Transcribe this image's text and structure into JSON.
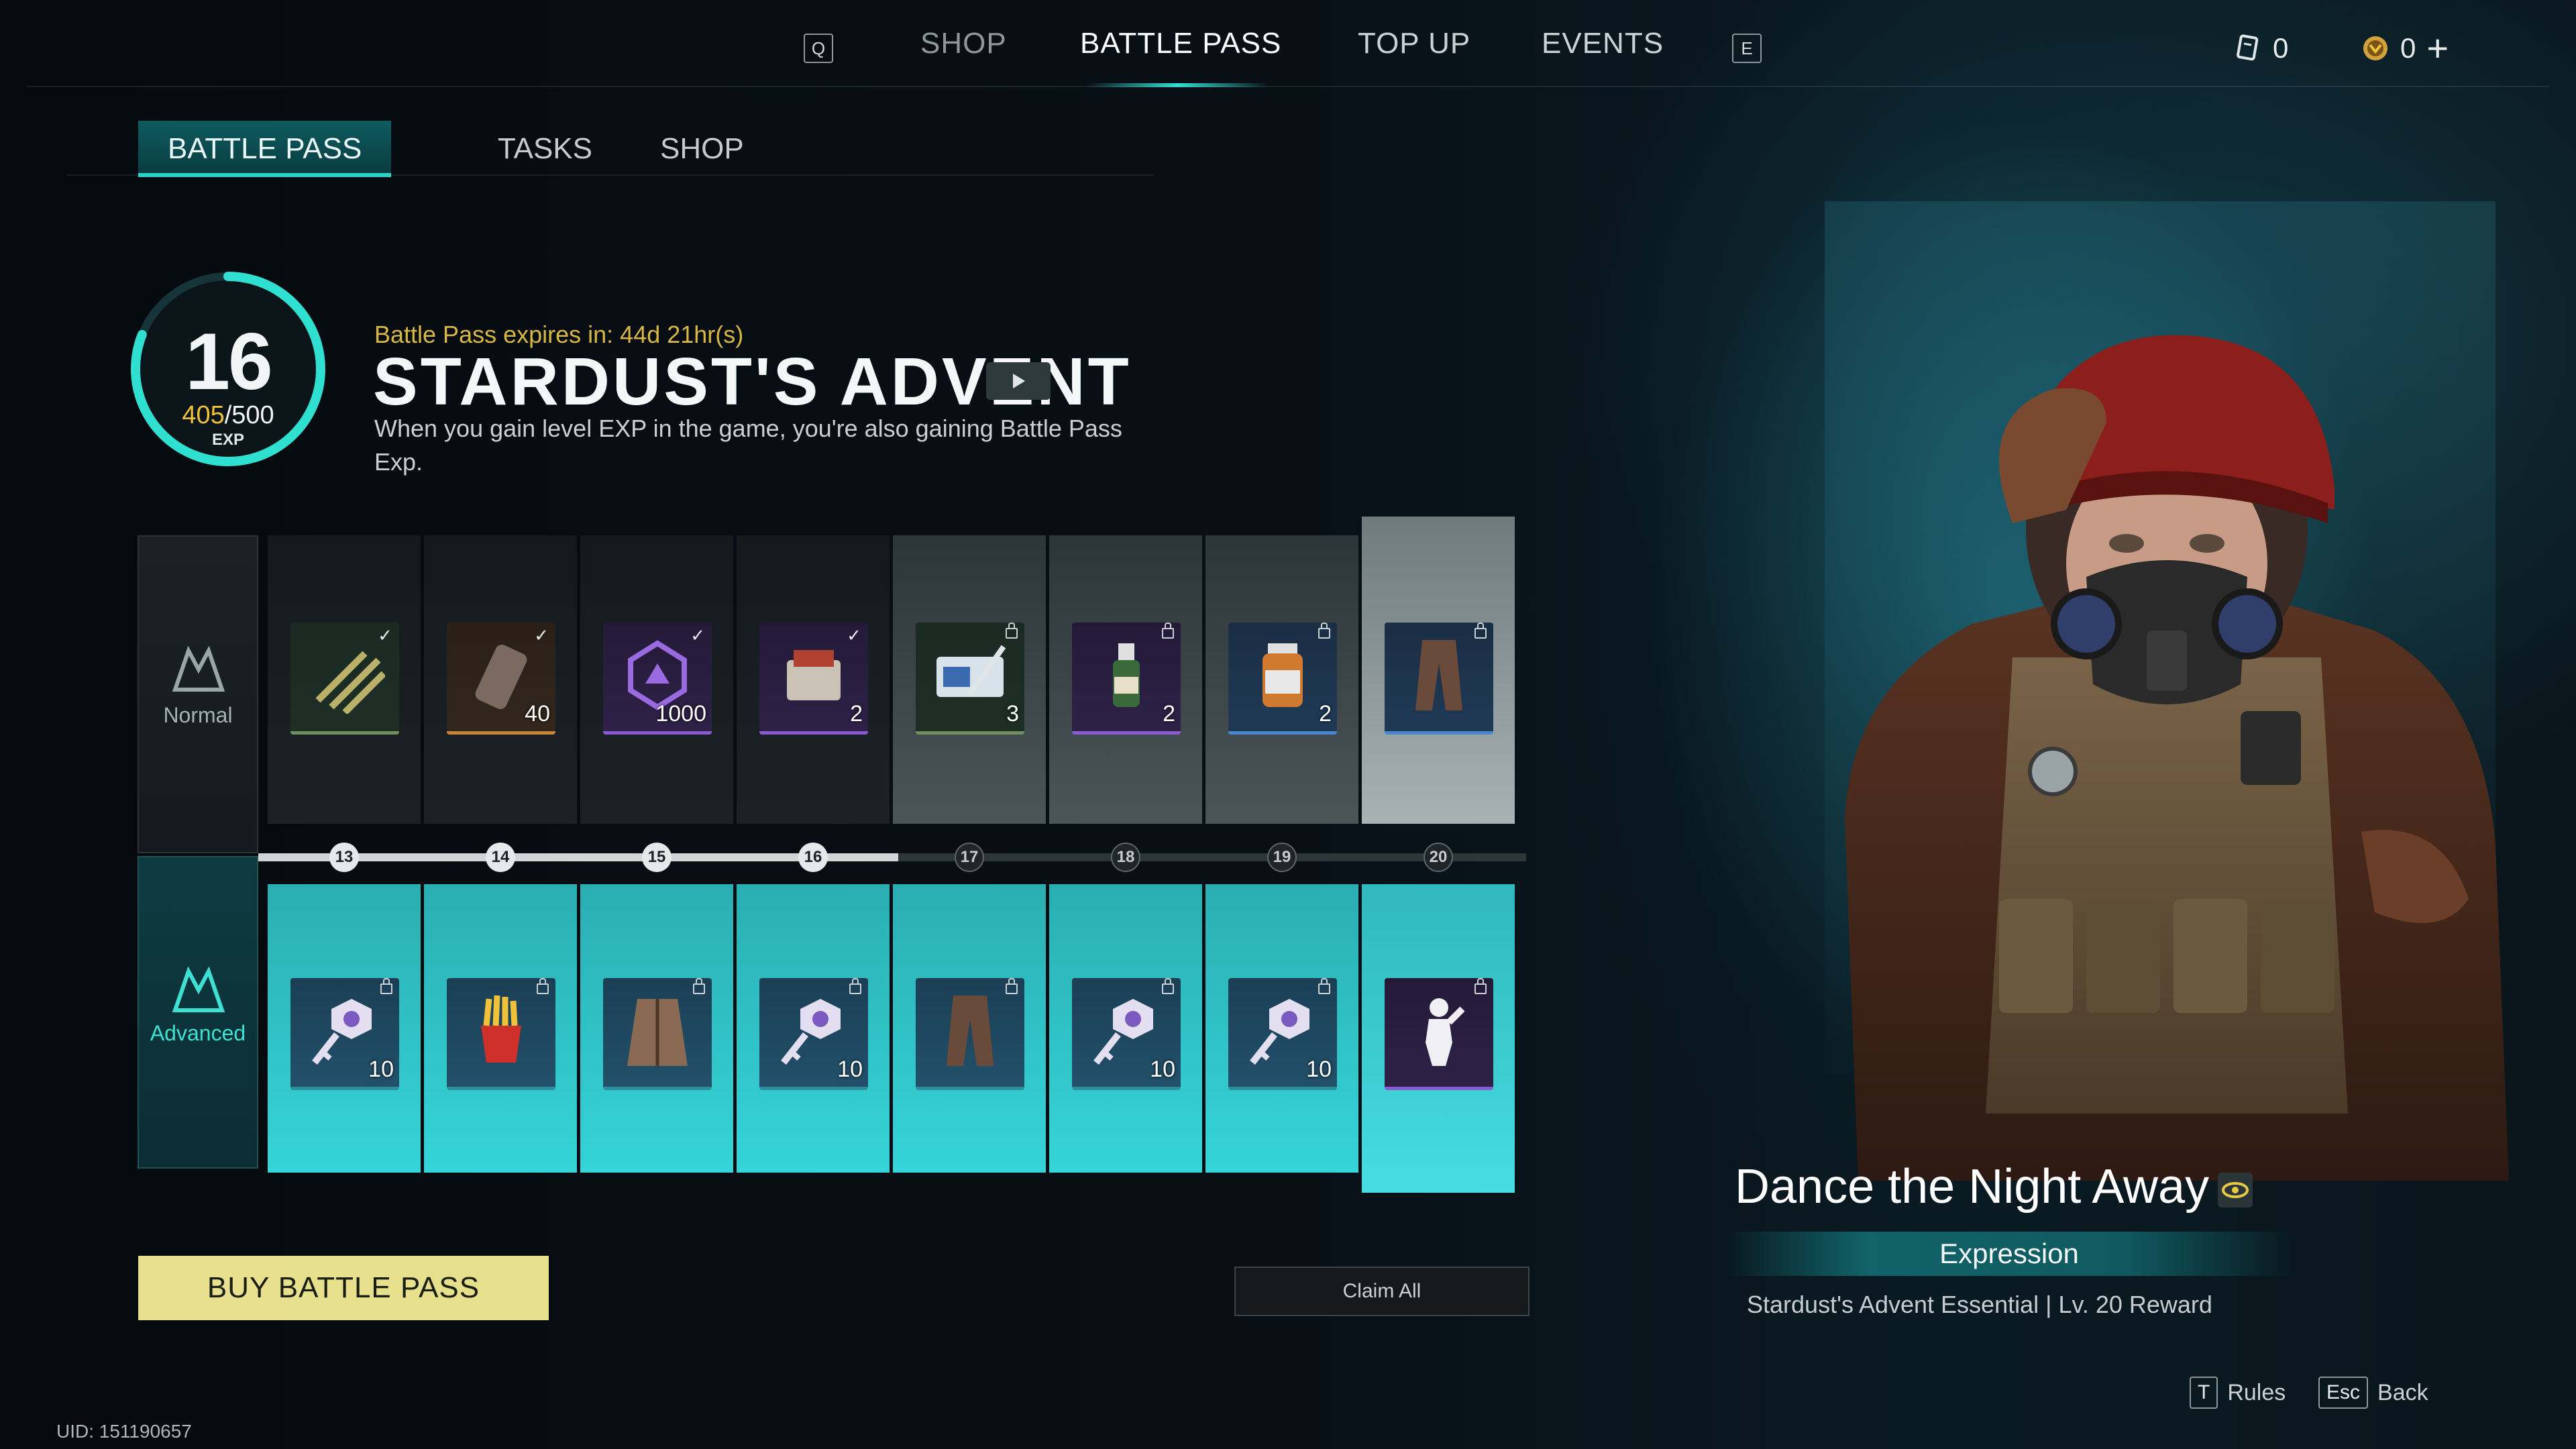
{
  "top_nav": {
    "left_key": "Q",
    "right_key": "E",
    "items": [
      {
        "label": "SHOP"
      },
      {
        "label": "BATTLE PASS"
      },
      {
        "label": "TOP UP"
      },
      {
        "label": "EVENTS"
      }
    ],
    "active": "BATTLE PASS",
    "currencies": [
      {
        "icon": "ticket-icon",
        "value": "0"
      },
      {
        "icon": "coin-icon",
        "value": "0"
      }
    ]
  },
  "sub_tabs": [
    {
      "label": "BATTLE PASS"
    },
    {
      "label": "TASKS"
    },
    {
      "label": "SHOP"
    }
  ],
  "level": {
    "value": "16",
    "exp_current": "405",
    "exp_total": "/500",
    "exp_label": "EXP",
    "progress_fraction": 0.81
  },
  "battle_pass": {
    "expires": "Battle Pass expires in: 44d 21hr(s)",
    "title": "STARDUST'S ADVENT",
    "description": "When you gain level EXP in the game, you're also gaining Battle Pass Exp."
  },
  "track": {
    "normal_label": "Normal",
    "advanced_label": "Advanced",
    "levels": [
      "13",
      "14",
      "15",
      "16",
      "17",
      "18",
      "19",
      "20"
    ],
    "current_level_index": 3,
    "normal_rewards": [
      {
        "icon": "ammo-icon",
        "qty": "",
        "tier": "green",
        "state": "claimed"
      },
      {
        "icon": "canister-icon",
        "qty": "40",
        "tier": "orange",
        "state": "claimed"
      },
      {
        "icon": "crystal-icon",
        "qty": "1000",
        "tier": "purple",
        "state": "claimed"
      },
      {
        "icon": "ration-icon",
        "qty": "2",
        "tier": "purple",
        "state": "claimed"
      },
      {
        "icon": "medkit-icon",
        "qty": "3",
        "tier": "green",
        "state": "locked"
      },
      {
        "icon": "bottle-icon",
        "qty": "2",
        "tier": "purple",
        "state": "locked"
      },
      {
        "icon": "jar-icon",
        "qty": "2",
        "tier": "blue",
        "state": "locked"
      },
      {
        "icon": "pants-icon",
        "qty": "",
        "tier": "blue",
        "state": "locked"
      }
    ],
    "advanced_rewards": [
      {
        "icon": "key-icon",
        "qty": "10",
        "tier": "teal",
        "state": "locked"
      },
      {
        "icon": "fries-icon",
        "qty": "",
        "tier": "teal",
        "state": "locked"
      },
      {
        "icon": "coat-icon",
        "qty": "",
        "tier": "teal",
        "state": "locked"
      },
      {
        "icon": "key-icon",
        "qty": "10",
        "tier": "teal",
        "state": "locked"
      },
      {
        "icon": "pants-icon",
        "qty": "",
        "tier": "teal",
        "state": "locked"
      },
      {
        "icon": "key-icon",
        "qty": "10",
        "tier": "teal",
        "state": "locked"
      },
      {
        "icon": "key-icon",
        "qty": "10",
        "tier": "teal",
        "state": "locked"
      },
      {
        "icon": "expression-icon",
        "qty": "",
        "tier": "purple",
        "state": "locked"
      }
    ]
  },
  "buttons": {
    "buy": "BUY BATTLE PASS",
    "claim_all": "Claim All"
  },
  "reward_preview": {
    "name": "Dance the Night Away",
    "type": "Expression",
    "source": "Stardust's Advent Essential | Lv. 20 Reward"
  },
  "hints": [
    {
      "key": "T",
      "label": "Rules"
    },
    {
      "key": "Esc",
      "label": "Back"
    }
  ],
  "uid": "UID: 151190657",
  "colors": {
    "accent": "#30e0d5",
    "gold": "#f0c23a",
    "buy_button": "#e8e08e"
  }
}
